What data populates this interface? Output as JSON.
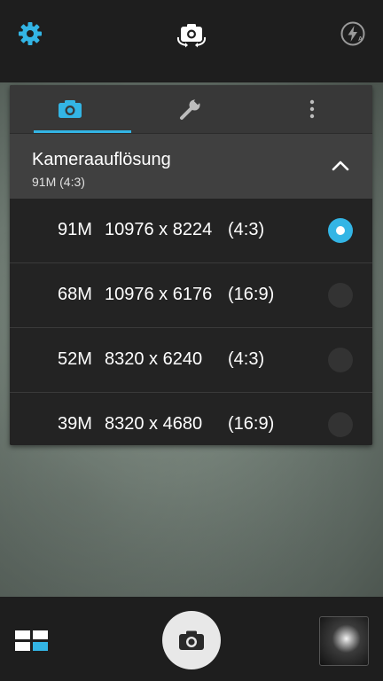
{
  "icons": {
    "settings": "gear-icon",
    "switch_camera": "switch-camera-icon",
    "flash": "flash-auto-icon",
    "tab_camera": "camera-icon",
    "tab_tools": "wrench-icon",
    "tab_more": "more-vertical-icon",
    "collapse": "chevron-up-icon",
    "mode": "mode-grid-icon",
    "shutter": "camera-icon"
  },
  "colors": {
    "accent": "#33b5e5",
    "top_bar": "#1e1e1e",
    "panel": "#262626"
  },
  "setting": {
    "title": "Kameraauflösung",
    "value": "91M (4:3)"
  },
  "resolutions": [
    {
      "mp": "91M",
      "size": "10976 x 8224",
      "ratio": "(4:3)",
      "selected": true
    },
    {
      "mp": "68M",
      "size": "10976 x 6176",
      "ratio": "(16:9)",
      "selected": false
    },
    {
      "mp": "52M",
      "size": "8320 x 6240",
      "ratio": "(4:3)",
      "selected": false
    },
    {
      "mp": "39M",
      "size": "8320 x 4680",
      "ratio": "(16:9)",
      "selected": false
    }
  ]
}
